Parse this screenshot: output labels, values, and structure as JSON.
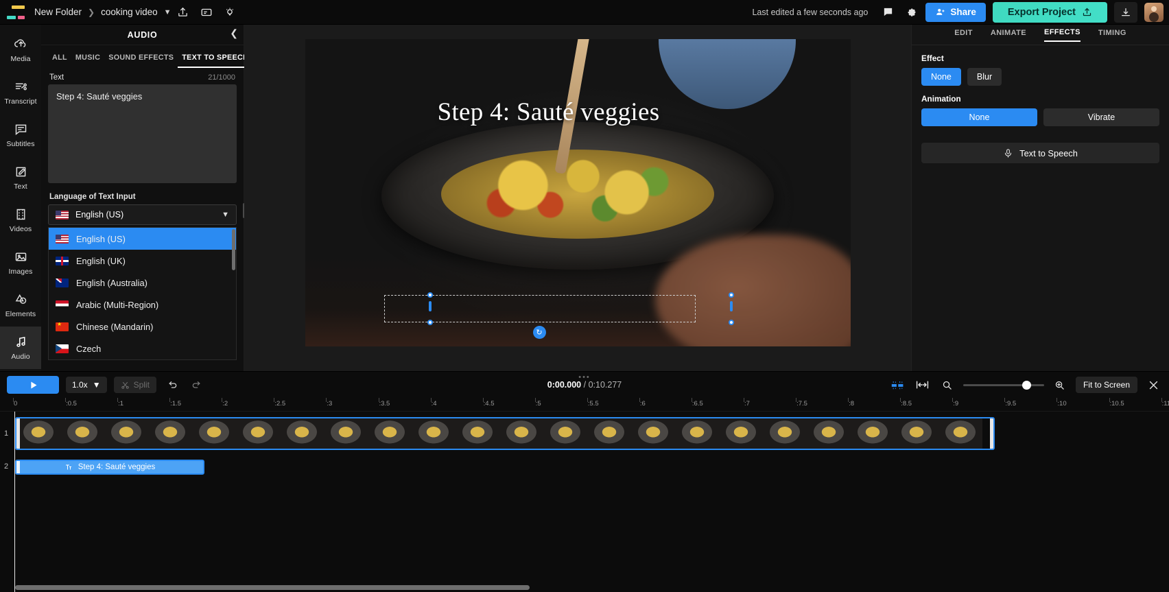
{
  "topbar": {
    "folder": "New Folder",
    "project": "cooking video",
    "last_edited": "Last edited a few seconds ago",
    "share_label": "Share",
    "export_label": "Export Project",
    "accent_blue": "#2b8bf2",
    "accent_teal": "#43dfc8"
  },
  "rail": {
    "items": [
      {
        "label": "Media",
        "icon": "cloud-upload-icon",
        "active": false
      },
      {
        "label": "Transcript",
        "icon": "transcript-icon",
        "active": false
      },
      {
        "label": "Subtitles",
        "icon": "subtitles-icon",
        "active": false
      },
      {
        "label": "Text",
        "icon": "text-edit-icon",
        "active": false
      },
      {
        "label": "Videos",
        "icon": "film-icon",
        "active": false
      },
      {
        "label": "Images",
        "icon": "image-icon",
        "active": false
      },
      {
        "label": "Elements",
        "icon": "shapes-icon",
        "active": false
      },
      {
        "label": "Audio",
        "icon": "music-note-icon",
        "active": true
      }
    ]
  },
  "panel": {
    "title": "AUDIO",
    "tabs": [
      {
        "label": "ALL",
        "active": false
      },
      {
        "label": "MUSIC",
        "active": false
      },
      {
        "label": "SOUND EFFECTS",
        "active": false
      },
      {
        "label": "TEXT TO SPEECH",
        "active": true
      }
    ],
    "text_label": "Text",
    "counter": "21/1000",
    "text_value": "Step 4: Sauté veggies",
    "language_label": "Language of Text Input",
    "selected_language": "English (US)",
    "options": [
      {
        "label": "English (US)",
        "flag": "f-us",
        "selected": true
      },
      {
        "label": "English (UK)",
        "flag": "f-uk",
        "selected": false
      },
      {
        "label": "English (Australia)",
        "flag": "f-au",
        "selected": false
      },
      {
        "label": "Arabic (Multi-Region)",
        "flag": "f-eg",
        "selected": false
      },
      {
        "label": "Chinese (Mandarin)",
        "flag": "f-cn",
        "selected": false
      },
      {
        "label": "Czech",
        "flag": "f-cz",
        "selected": false
      }
    ]
  },
  "canvas": {
    "overlay_text": "Step 4: Sauté veggies"
  },
  "right": {
    "tabs": [
      {
        "label": "EDIT",
        "active": false
      },
      {
        "label": "ANIMATE",
        "active": false
      },
      {
        "label": "EFFECTS",
        "active": true
      },
      {
        "label": "TIMING",
        "active": false
      }
    ],
    "effect_label": "Effect",
    "effects": [
      {
        "label": "None",
        "on": true
      },
      {
        "label": "Blur",
        "on": false
      }
    ],
    "animation_label": "Animation",
    "animations": [
      {
        "label": "None",
        "on": true
      },
      {
        "label": "Vibrate",
        "on": false
      }
    ],
    "tts_button": "Text to Speech"
  },
  "timeline": {
    "speed": "1.0x",
    "split_label": "Split",
    "current_time": "0:00.000",
    "total_time": "0:10.277",
    "separator": "/",
    "fit_label": "Fit to Screen",
    "ticks": [
      "0",
      ":0.5",
      ":1",
      ":1.5",
      ":2",
      ":2.5",
      ":3",
      ":3.5",
      ":4",
      ":4.5",
      ":5",
      ":5.5",
      ":6",
      ":6.5",
      ":7",
      ":7.5",
      ":8",
      ":8.5",
      ":9",
      ":9.5",
      ":10",
      ":10.5",
      ":11"
    ],
    "rows": [
      "1",
      "2"
    ],
    "text_clip_label": "Step 4: Sauté veggies"
  }
}
